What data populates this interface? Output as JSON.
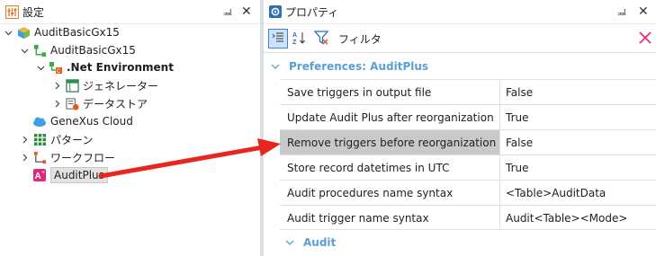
{
  "left_panel": {
    "title": "設定",
    "pin_glyph": "ᆋ",
    "close_glyph": "✕",
    "tree": [
      {
        "label": "AuditBasicGx15",
        "bold": false,
        "icon": "kb-cube-icon"
      },
      {
        "label": "AuditBasicGx15",
        "bold": false,
        "icon": "version-tree-icon"
      },
      {
        "label": ".Net Environment",
        "bold": true,
        "icon": "net-environment-icon"
      },
      {
        "label": "ジェネレーター",
        "bold": false,
        "icon": "generator-icon"
      },
      {
        "label": "データストア",
        "bold": false,
        "icon": "datastore-icon"
      },
      {
        "label": "GeneXus Cloud",
        "bold": false,
        "icon": "cloud-icon"
      },
      {
        "label": "パターン",
        "bold": false,
        "icon": "patterns-icon"
      },
      {
        "label": "ワークフロー",
        "bold": false,
        "icon": "workflow-icon"
      },
      {
        "label": "AuditPlus",
        "bold": false,
        "icon": "auditplus-icon",
        "selected": true
      }
    ]
  },
  "right_panel": {
    "title": "プロパティ",
    "pin_glyph": "ᆋ",
    "close_glyph": "✕",
    "toolbar": {
      "filter_label": "フィルタ",
      "filter_value": "",
      "sort_az_glyph": "A\nZ"
    },
    "categories": [
      {
        "label": "Preferences: AuditPlus"
      },
      {
        "label": "Audit"
      }
    ],
    "properties": [
      {
        "name": "Save triggers in output file",
        "value": "False"
      },
      {
        "name": "Update Audit Plus after reorganization",
        "value": "True"
      },
      {
        "name": "Remove triggers before reorganization",
        "value": "False",
        "highlighted": true
      },
      {
        "name": "Store record datetimes in UTC",
        "value": "True"
      },
      {
        "name": "Audit procedures name syntax",
        "value": "<Table>AuditData"
      },
      {
        "name": "Audit trigger name syntax",
        "value": "Audit<Table><Mode>"
      }
    ]
  },
  "colors": {
    "annotation_arrow": "#e8251f",
    "category_text": "#5a9fd4",
    "highlight_row": "#c9c9c9",
    "selected_toolbar_button": "#cfe2fb"
  }
}
